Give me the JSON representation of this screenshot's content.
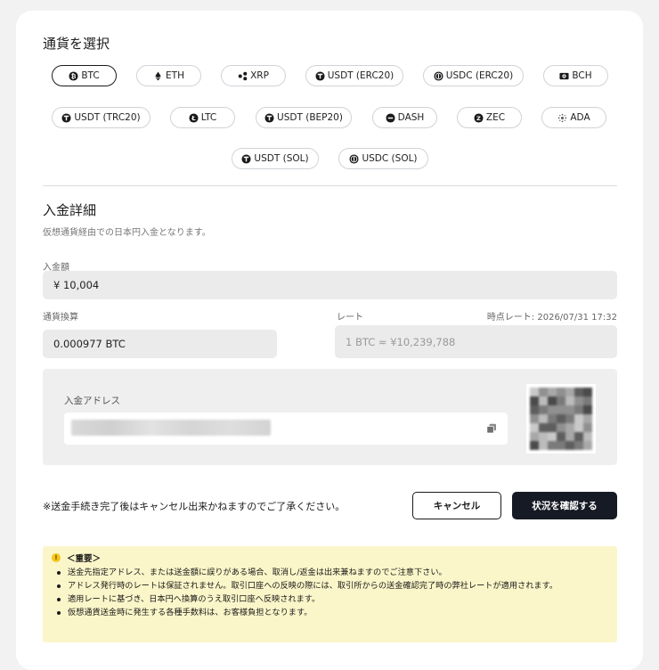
{
  "currency_section": {
    "title": "通貨を選択",
    "currencies": [
      {
        "label": "BTC",
        "icon": "bitcoin-icon"
      },
      {
        "label": "ETH",
        "icon": "ethereum-icon"
      },
      {
        "label": "XRP",
        "icon": "xrp-icon"
      },
      {
        "label": "USDT (ERC20)",
        "icon": "tether-icon"
      },
      {
        "label": "USDC (ERC20)",
        "icon": "usdc-icon"
      },
      {
        "label": "BCH",
        "icon": "bch-icon"
      },
      {
        "label": "USDT (TRC20)",
        "icon": "tether-icon"
      },
      {
        "label": "LTC",
        "icon": "litecoin-icon"
      },
      {
        "label": "USDT (BEP20)",
        "icon": "tether-icon"
      },
      {
        "label": "DASH",
        "icon": "dash-icon"
      },
      {
        "label": "ZEC",
        "icon": "zcash-icon"
      },
      {
        "label": "ADA",
        "icon": "cardano-icon"
      },
      {
        "label": "USDT (SOL)",
        "icon": "tether-icon"
      },
      {
        "label": "USDC (SOL)",
        "icon": "usdc-icon"
      }
    ],
    "selected": "BTC"
  },
  "deposit": {
    "title": "入金詳細",
    "subtitle": "仮想通貨経由での日本円入金となります。",
    "amount_label": "入金額",
    "amount_value": "¥ 10,004",
    "conversion_label": "通貨換算",
    "conversion_value": "0.000977 BTC",
    "rate_label": "レート",
    "rate_time": "時点レート: 2026/07/31 17:32",
    "rate_value": "1 BTC ≈ ¥10,239,788",
    "address_label": "入金アドレス"
  },
  "notice": "※送金手続き完了後はキャンセル出来かねますのでご了承ください。",
  "buttons": {
    "cancel": "キャンセル",
    "confirm": "状況を確認する"
  },
  "important": {
    "icon_glyph": "!",
    "heading": "＜重要＞",
    "items": [
      "送金先指定アドレス、または送金額に誤りがある場合、取消し/返金は出来兼ねますのでご注意下さい。",
      "アドレス発行時のレートは保証されません。取引口座への反映の際には、取引所からの送金確認完了時の弊社レートが適用されます。",
      "適用レートに基づき、日本円へ換算のうえ取引口座へ反映されます。",
      "仮想通貨送金時に発生する各種手数料は、お客様負担となります。"
    ]
  },
  "colors": {
    "accent_dark": "#161a24",
    "alert_bg": "#fbf6c9",
    "alert_icon": "#f5c518"
  }
}
